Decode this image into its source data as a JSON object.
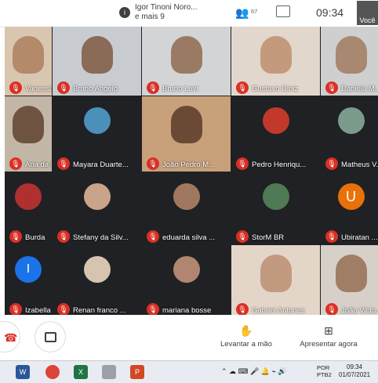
{
  "topbar": {
    "notification_line1": "Igor Tinoni Noro...",
    "notification_line2": "e mais 9",
    "people_count": "67",
    "time": "09:34",
    "self_label": "Você"
  },
  "tiles": [
    {
      "name": "Vanessa Pac...",
      "type": "video",
      "color": "#d9c6b0",
      "face": "#b48a6a"
    },
    {
      "name": "Bruno Angelo",
      "type": "video",
      "color": "#c8ccd0",
      "face": "#8a6b57"
    },
    {
      "name": "Bruno Levi",
      "type": "video",
      "color": "#d2d4d6",
      "face": "#9b7a63"
    },
    {
      "name": "Gustavo Diniz",
      "type": "video",
      "color": "#e1d7cc",
      "face": "#c49a7c"
    },
    {
      "name": "Daniela M...",
      "type": "video",
      "color": "#cfcfcf",
      "face": "#a88870"
    },
    {
      "name": "Ana da Rosa ...",
      "type": "video",
      "color": "#c2b6a6",
      "face": "#6e5440"
    },
    {
      "name": "Mayara Duarte...",
      "type": "avatar",
      "avatar_color": "#4a90b8"
    },
    {
      "name": "João Pedro M...",
      "type": "video",
      "color": "#c8a07a",
      "face": "#6a4a34"
    },
    {
      "name": "Pedro Henriqu...",
      "type": "avatar",
      "avatar_color": "#c0392b"
    },
    {
      "name": "Matheus V...",
      "type": "avatar",
      "avatar_color": "#7a9a8c"
    },
    {
      "name": "Burda",
      "type": "avatar",
      "avatar_color": "#b03030"
    },
    {
      "name": "Stefany da Silv...",
      "type": "avatar",
      "avatar_color": "#c9a38a"
    },
    {
      "name": "eduarda silva ...",
      "type": "avatar",
      "avatar_color": "#a07860"
    },
    {
      "name": "StorM BR",
      "type": "avatar",
      "avatar_color": "#4f7a55"
    },
    {
      "name": "Ubiratan ...",
      "type": "letter",
      "letter": "U"
    },
    {
      "name": "Izabella oriano",
      "type": "teal",
      "letter": "I"
    },
    {
      "name": "Renan franco ...",
      "type": "avatar",
      "avatar_color": "#d6c4b0"
    },
    {
      "name": "mariana bosse",
      "type": "avatar",
      "avatar_color": "#b08670"
    },
    {
      "name": "Gabriel Antunes",
      "type": "video",
      "color": "#e3d6c8",
      "face": "#c19a80"
    },
    {
      "name": "João Victo...",
      "type": "video",
      "color": "#d6d0c8",
      "face": "#a07e66"
    }
  ],
  "controls": {
    "raise_hand": "Levantar a mão",
    "present_now": "Apresentar agora"
  },
  "taskbar": {
    "lang1": "POR",
    "lang2": "PTB2",
    "time": "09:34",
    "date": "01/07/2021"
  }
}
